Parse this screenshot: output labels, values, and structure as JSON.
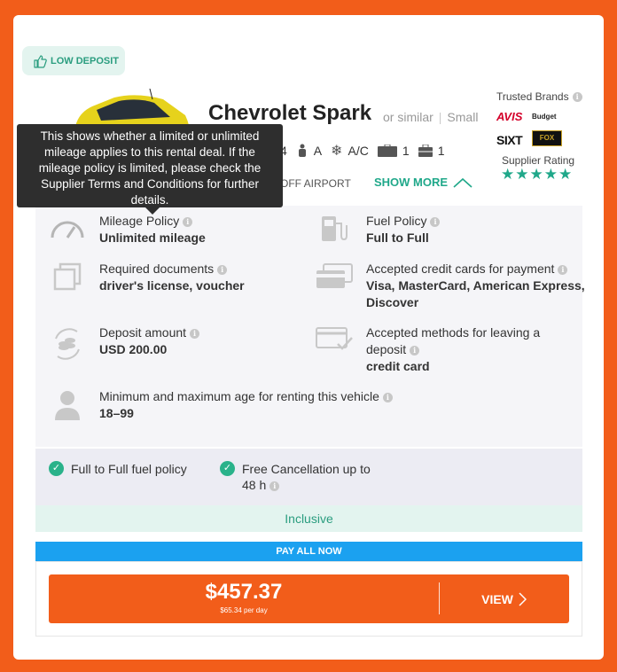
{
  "badge": {
    "label": "LOW DEPOSIT",
    "icon": "thumbs-up-icon"
  },
  "car": {
    "name": "Chevrolet Spark",
    "similar": "or similar",
    "category": "Small",
    "specs": {
      "seats": "4",
      "transmission": "A",
      "ac": "A/C",
      "bags_large": "1",
      "bags_small": "1"
    },
    "location": "OFF AIRPORT",
    "show_more": "SHOW MORE"
  },
  "supplier": {
    "trusted_title": "Trusted Brands",
    "brands": [
      "AVIS",
      "Budget",
      "SIXT",
      "FOX"
    ],
    "fox_sub": "RENT A CAR",
    "rating_title": "Supplier Rating",
    "rating": 5
  },
  "tooltip": "This shows whether a limited or unlimited mileage applies to this rental deal. If the mileage policy is limited, please check the Supplier Terms and Conditions for further details.",
  "features": {
    "mileage": {
      "label": "Mileage Policy",
      "value": "Unlimited mileage"
    },
    "fuel": {
      "label": "Fuel Policy",
      "value": "Full to Full"
    },
    "documents": {
      "label": "Required documents",
      "value": "driver's license, voucher"
    },
    "cards": {
      "label": "Accepted credit cards for payment",
      "value": "Visa, MasterCard, American Express, Discover"
    },
    "deposit": {
      "label": "Deposit amount",
      "value": "USD 200.00"
    },
    "deposit_methods": {
      "label": "Accepted methods for leaving a deposit",
      "value": "credit card"
    },
    "age": {
      "label": "Minimum and maximum age for renting this vehicle",
      "value": "18–99"
    }
  },
  "policies": {
    "fuel": "Full to Full fuel policy",
    "cancellation": "Free Cancellation up to 48 h",
    "inclusive": "Inclusive"
  },
  "payment": {
    "pay_all": "PAY ALL NOW",
    "price": "$457.37",
    "per_day": "$65.34 per day",
    "view": "VIEW"
  },
  "colors": {
    "accent": "#f25d1a",
    "teal": "#20a88a",
    "blue": "#1ba1f0"
  }
}
